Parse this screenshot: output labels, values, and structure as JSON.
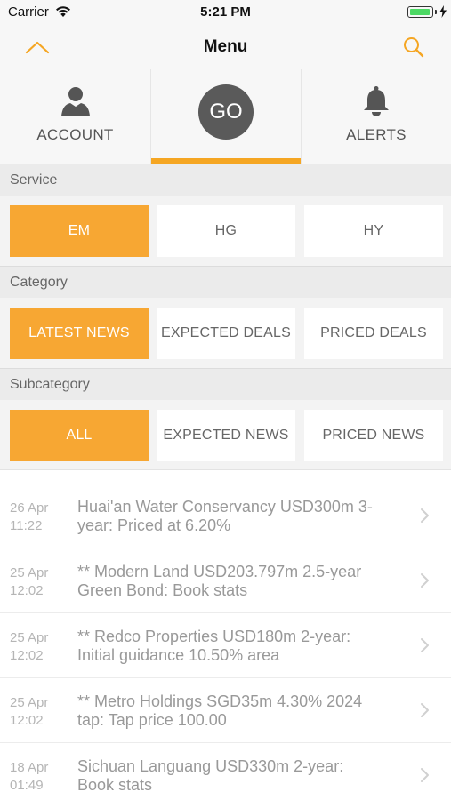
{
  "status_bar": {
    "carrier": "Carrier",
    "time": "5:21 PM",
    "battery_level": 0.8,
    "battery_color": "#4cd964"
  },
  "nav": {
    "title": "Menu",
    "left_icon": "chevron-up-icon",
    "right_icon": "search-icon",
    "accent": "#f5a623"
  },
  "tabs": [
    {
      "label": "ACCOUNT",
      "icon": "user-icon",
      "selected": false
    },
    {
      "label": "GO",
      "icon": "go-circle",
      "selected": true
    },
    {
      "label": "ALERTS",
      "icon": "bell-icon",
      "selected": false
    }
  ],
  "service": {
    "header": "Service",
    "options": [
      {
        "label": "EM",
        "selected": true
      },
      {
        "label": "HG",
        "selected": false
      },
      {
        "label": "HY",
        "selected": false
      }
    ]
  },
  "category": {
    "header": "Category",
    "options": [
      {
        "label": "LATEST NEWS",
        "selected": true
      },
      {
        "label": "EXPECTED DEALS",
        "selected": false
      },
      {
        "label": "PRICED DEALS",
        "selected": false
      }
    ]
  },
  "subcategory": {
    "header": "Subcategory",
    "options": [
      {
        "label": "ALL",
        "selected": true
      },
      {
        "label": "EXPECTED NEWS",
        "selected": false
      },
      {
        "label": "PRICED NEWS",
        "selected": false
      }
    ]
  },
  "news": [
    {
      "date": "26 Apr",
      "time": "11:22",
      "title_line1": "Huai'an Water Conservancy USD300m 3-",
      "title_line2": "year: Priced at 6.20%"
    },
    {
      "date": "25 Apr",
      "time": "12:02",
      "title_line1": "** Modern Land USD203.797m 2.5-year",
      "title_line2": "Green Bond: Book stats"
    },
    {
      "date": "25 Apr",
      "time": "12:02",
      "title_line1": "** Redco Properties USD180m 2-year:",
      "title_line2": "Initial guidance 10.50% area"
    },
    {
      "date": "25 Apr",
      "time": "12:02",
      "title_line1": "** Metro Holdings SGD35m 4.30% 2024",
      "title_line2": "tap: Tap price 100.00"
    },
    {
      "date": "18 Apr",
      "time": "01:49",
      "title_line1": "Sichuan Languang USD330m 2-year:",
      "title_line2": "Book stats"
    }
  ],
  "colors": {
    "accent": "#f7a733",
    "section_bg": "#ebebeb",
    "muted_text": "#999999"
  }
}
